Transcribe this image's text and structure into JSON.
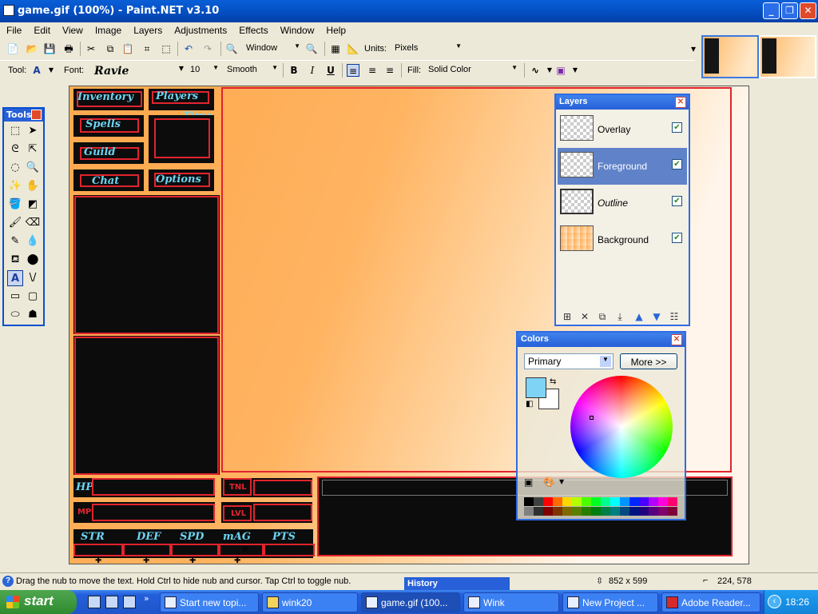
{
  "window": {
    "title": "game.gif (100%) - Paint.NET v3.10"
  },
  "menu": [
    "File",
    "Edit",
    "View",
    "Image",
    "Layers",
    "Adjustments",
    "Effects",
    "Window",
    "Help"
  ],
  "toolbar1": {
    "zoom_combo": "Window",
    "units_label": "Units:",
    "units_value": "Pixels"
  },
  "toolbar2": {
    "tool_label": "Tool:",
    "tool_icon": "A",
    "font_label": "Font:",
    "font_value": "Ravie",
    "size_value": "10",
    "smooth_value": "Smooth",
    "bold": "B",
    "italic": "I",
    "underline": "U",
    "fill_label": "Fill:",
    "fill_value": "Solid Color"
  },
  "canvas_labels": {
    "inventory": "Inventory",
    "players": "Players",
    "time": "Time",
    "spells": "Spells",
    "guild": "Guild",
    "chat": "Chat",
    "options": "Options",
    "hp": "HP",
    "mp": "MP",
    "tnl": "TNL",
    "lvl": "LVL",
    "str": "STR",
    "def": "DEF",
    "spd": "SPD",
    "mag": "mAG",
    "pts": "PTS"
  },
  "tools_panel": {
    "title": "Tools"
  },
  "layers_panel": {
    "title": "Layers",
    "layers": [
      {
        "name": "Overlay",
        "visible": true
      },
      {
        "name": "Foreground",
        "visible": true,
        "selected": true
      },
      {
        "name": "Outline",
        "visible": true
      },
      {
        "name": "Background",
        "visible": true
      }
    ]
  },
  "colors_panel": {
    "title": "Colors",
    "mode": "Primary",
    "more_button": "More >>",
    "primary_color": "#7fd3f5",
    "secondary_color": "#ffffff"
  },
  "status": {
    "message": "Drag the nub to move the text. Hold Ctrl to hide nub and cursor. Tap Ctrl to toggle nub.",
    "image_size": "852 x 599",
    "cursor_pos": "224, 578"
  },
  "history_panel": {
    "title": "History"
  },
  "taskbar": {
    "start": "start",
    "tasks": [
      "Start new topi...",
      "wink20",
      "game.gif (100...",
      "Wink",
      "New Project ...",
      "Adobe Reader..."
    ],
    "clock": "18:26"
  }
}
